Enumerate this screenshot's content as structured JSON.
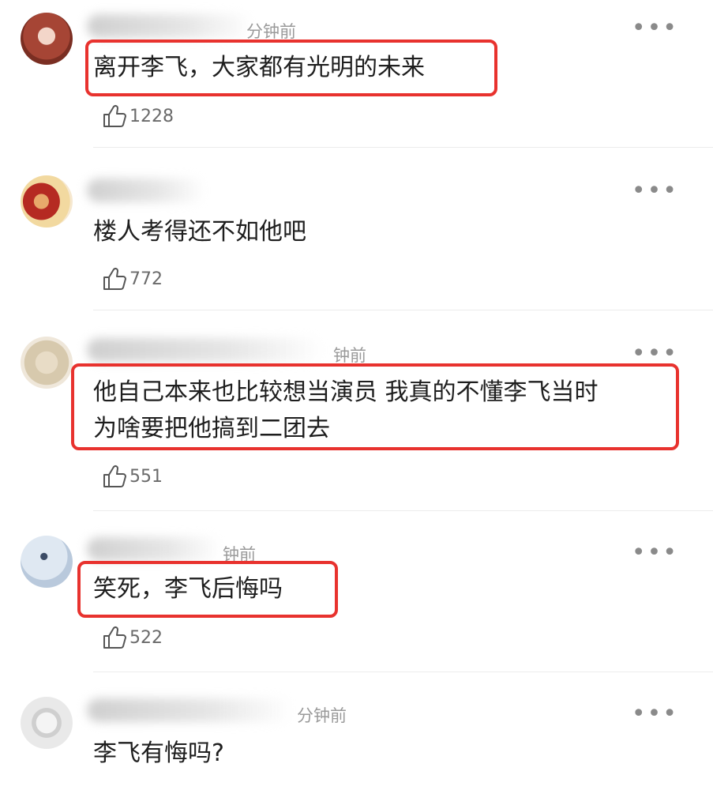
{
  "comments": [
    {
      "time": "分钟前",
      "text_lines": [
        "离开李飞，大家都有光明的未来"
      ],
      "likes": "1228",
      "highlighted": true
    },
    {
      "time": "",
      "text_lines": [
        "楼人考得还不如他吧"
      ],
      "likes": "772",
      "highlighted": false
    },
    {
      "time": "钟前",
      "text_lines": [
        "他自己本来也比较想当演员 我真的不懂李飞当时",
        "为啥要把他搞到二团去"
      ],
      "likes": "551",
      "highlighted": true
    },
    {
      "time": "钟前",
      "text_lines": [
        "笑死，李飞后悔吗"
      ],
      "likes": "522",
      "highlighted": true
    },
    {
      "time": "分钟前",
      "text_lines": [
        "李飞有悔吗?"
      ],
      "likes": "",
      "highlighted": false
    }
  ],
  "more_label": "•••",
  "accent_color": "#e8322e",
  "icons": {
    "like": "thumbs-up-icon",
    "more": "more-dots-icon"
  }
}
